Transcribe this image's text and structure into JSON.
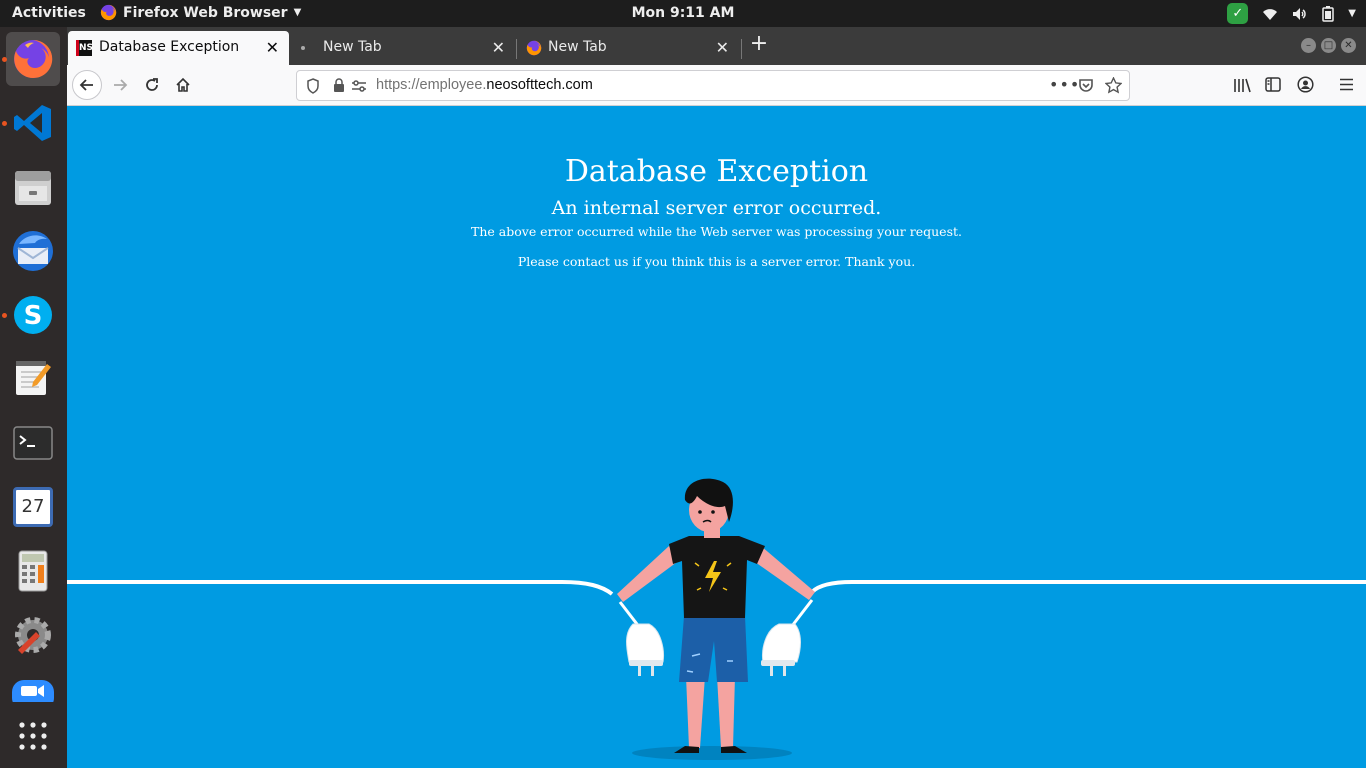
{
  "topbar": {
    "activities": "Activities",
    "app_name": "Firefox Web Browser",
    "clock": "Mon  9:11 AM"
  },
  "dock": {
    "items": [
      "firefox-icon",
      "vscode-icon",
      "files-icon",
      "thunderbird-icon",
      "skype-icon",
      "text-editor-icon",
      "terminal-icon",
      "calendar-icon",
      "calculator-icon",
      "settings-icon",
      "zoom-icon",
      "app-grid-icon"
    ],
    "calendar_day": "27"
  },
  "browser": {
    "tabs": [
      {
        "title": "Database Exception",
        "favicon": "NS"
      },
      {
        "title": "New Tab"
      },
      {
        "title": "New Tab"
      }
    ],
    "url_prefix": "https://employee.",
    "url_domain": "neosofttech.com"
  },
  "page": {
    "title": "Database Exception",
    "subtitle": "An internal server error occurred.",
    "line1": "The above error occurred while the Web server was processing your request.",
    "line2": "Please contact us if you think this is a server error. Thank you."
  },
  "colors": {
    "page_bg": "#009be2",
    "accent": "#e95420"
  }
}
